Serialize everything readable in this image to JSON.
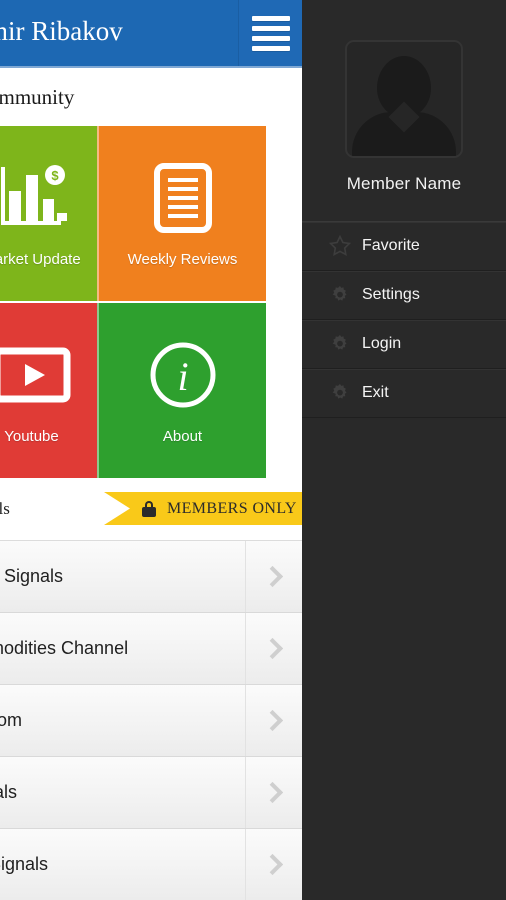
{
  "app": {
    "header": {
      "title": "dimir Ribakov",
      "menu_icon": "hamburger-icon"
    },
    "section_title": "Community",
    "tiles": [
      {
        "label": "Market Update",
        "icon": "bar-chart-dollar-icon",
        "color": "#7eb51b"
      },
      {
        "label": "Weekly Reviews",
        "icon": "document-lines-icon",
        "color": "#f0801e"
      },
      {
        "label": "Youtube",
        "icon": "play-button-icon",
        "color": "#e03b36"
      },
      {
        "label": "About",
        "icon": "info-circle-icon",
        "color": "#2ea02e"
      }
    ],
    "ribbon_strip": {
      "left_text": "gnals",
      "badge_text": "MEMBERS ONLY",
      "badge_icon": "lock-icon",
      "badge_color": "#f9c919"
    },
    "list": [
      {
        "label": "rex Signals"
      },
      {
        "label": "mmodities Channel"
      },
      {
        "label": "Room"
      },
      {
        "label": "gnals"
      },
      {
        "label": "e Signals"
      }
    ]
  },
  "drawer": {
    "avatar_icon": "user-silhouette-icon",
    "member_name": "Member Name",
    "background": "#292929",
    "items": [
      {
        "label": "Favorite",
        "icon": "star-icon"
      },
      {
        "label": "Settings",
        "icon": "gear-icon"
      },
      {
        "label": "Login",
        "icon": "gear-icon"
      },
      {
        "label": "Exit",
        "icon": "gear-icon"
      }
    ]
  }
}
